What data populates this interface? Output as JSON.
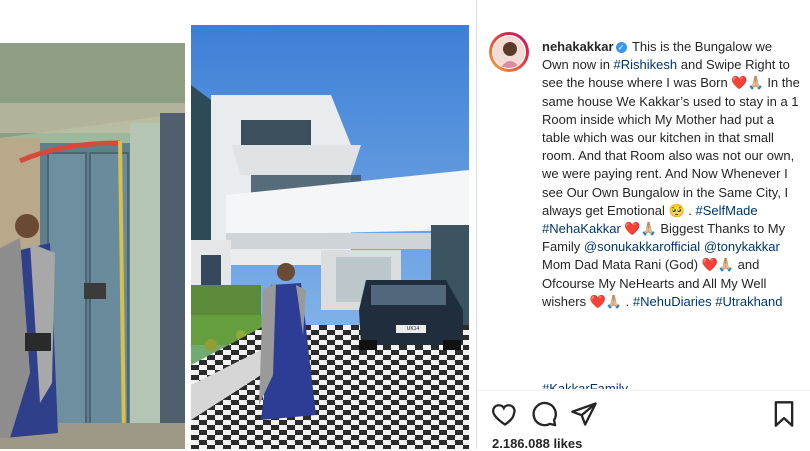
{
  "post": {
    "username": "nehakakkar",
    "caption_parts": [
      {
        "text": "This is the Bungalow we Own now in ",
        "tag": false
      },
      {
        "text": "#Rishikesh",
        "tag": true
      },
      {
        "text": " and Swipe Right to see the house where I was Born ❤️🙏🏼 In the same house We Kakkar’s used to stay in a 1 Room inside which My Mother had put a table which was our kitchen in that small room. And that Room also was not our own, we were paying rent. And Now Whenever I see Our Own Bungalow in the Same City, I always get Emotional 🥺 . ",
        "tag": false
      },
      {
        "text": "#SelfMade",
        "tag": true
      },
      {
        "text": " ",
        "tag": false
      },
      {
        "text": "#NehaKakkar",
        "tag": true
      },
      {
        "text": " ❤️🙏🏼 Biggest Thanks to My Family ",
        "tag": false
      },
      {
        "text": "@sonukakkarofficial",
        "tag": true
      },
      {
        "text": " ",
        "tag": false
      },
      {
        "text": "@tonykakkar",
        "tag": true
      },
      {
        "text": " Mom Dad Mata Rani (God) ❤️🙏🏼 and Ofcourse My NeHearts and All My Well wishers ❤️🙏🏼 . ",
        "tag": false
      },
      {
        "text": "#NehuDiaries",
        "tag": true
      },
      {
        "text": " ",
        "tag": false
      },
      {
        "text": "#Utrakhand",
        "tag": true
      }
    ],
    "cut_line": "#KakkarFamily",
    "likes": "2.186.088 likes",
    "car_plate": "UK14 F0000"
  },
  "icons": {
    "like": "heart-icon",
    "comment": "comment-icon",
    "share": "share-icon",
    "save": "bookmark-icon",
    "verified": "verified-badge-icon"
  },
  "colors": {
    "link": "#00376b",
    "verified": "#3897f0",
    "text": "#262626"
  }
}
